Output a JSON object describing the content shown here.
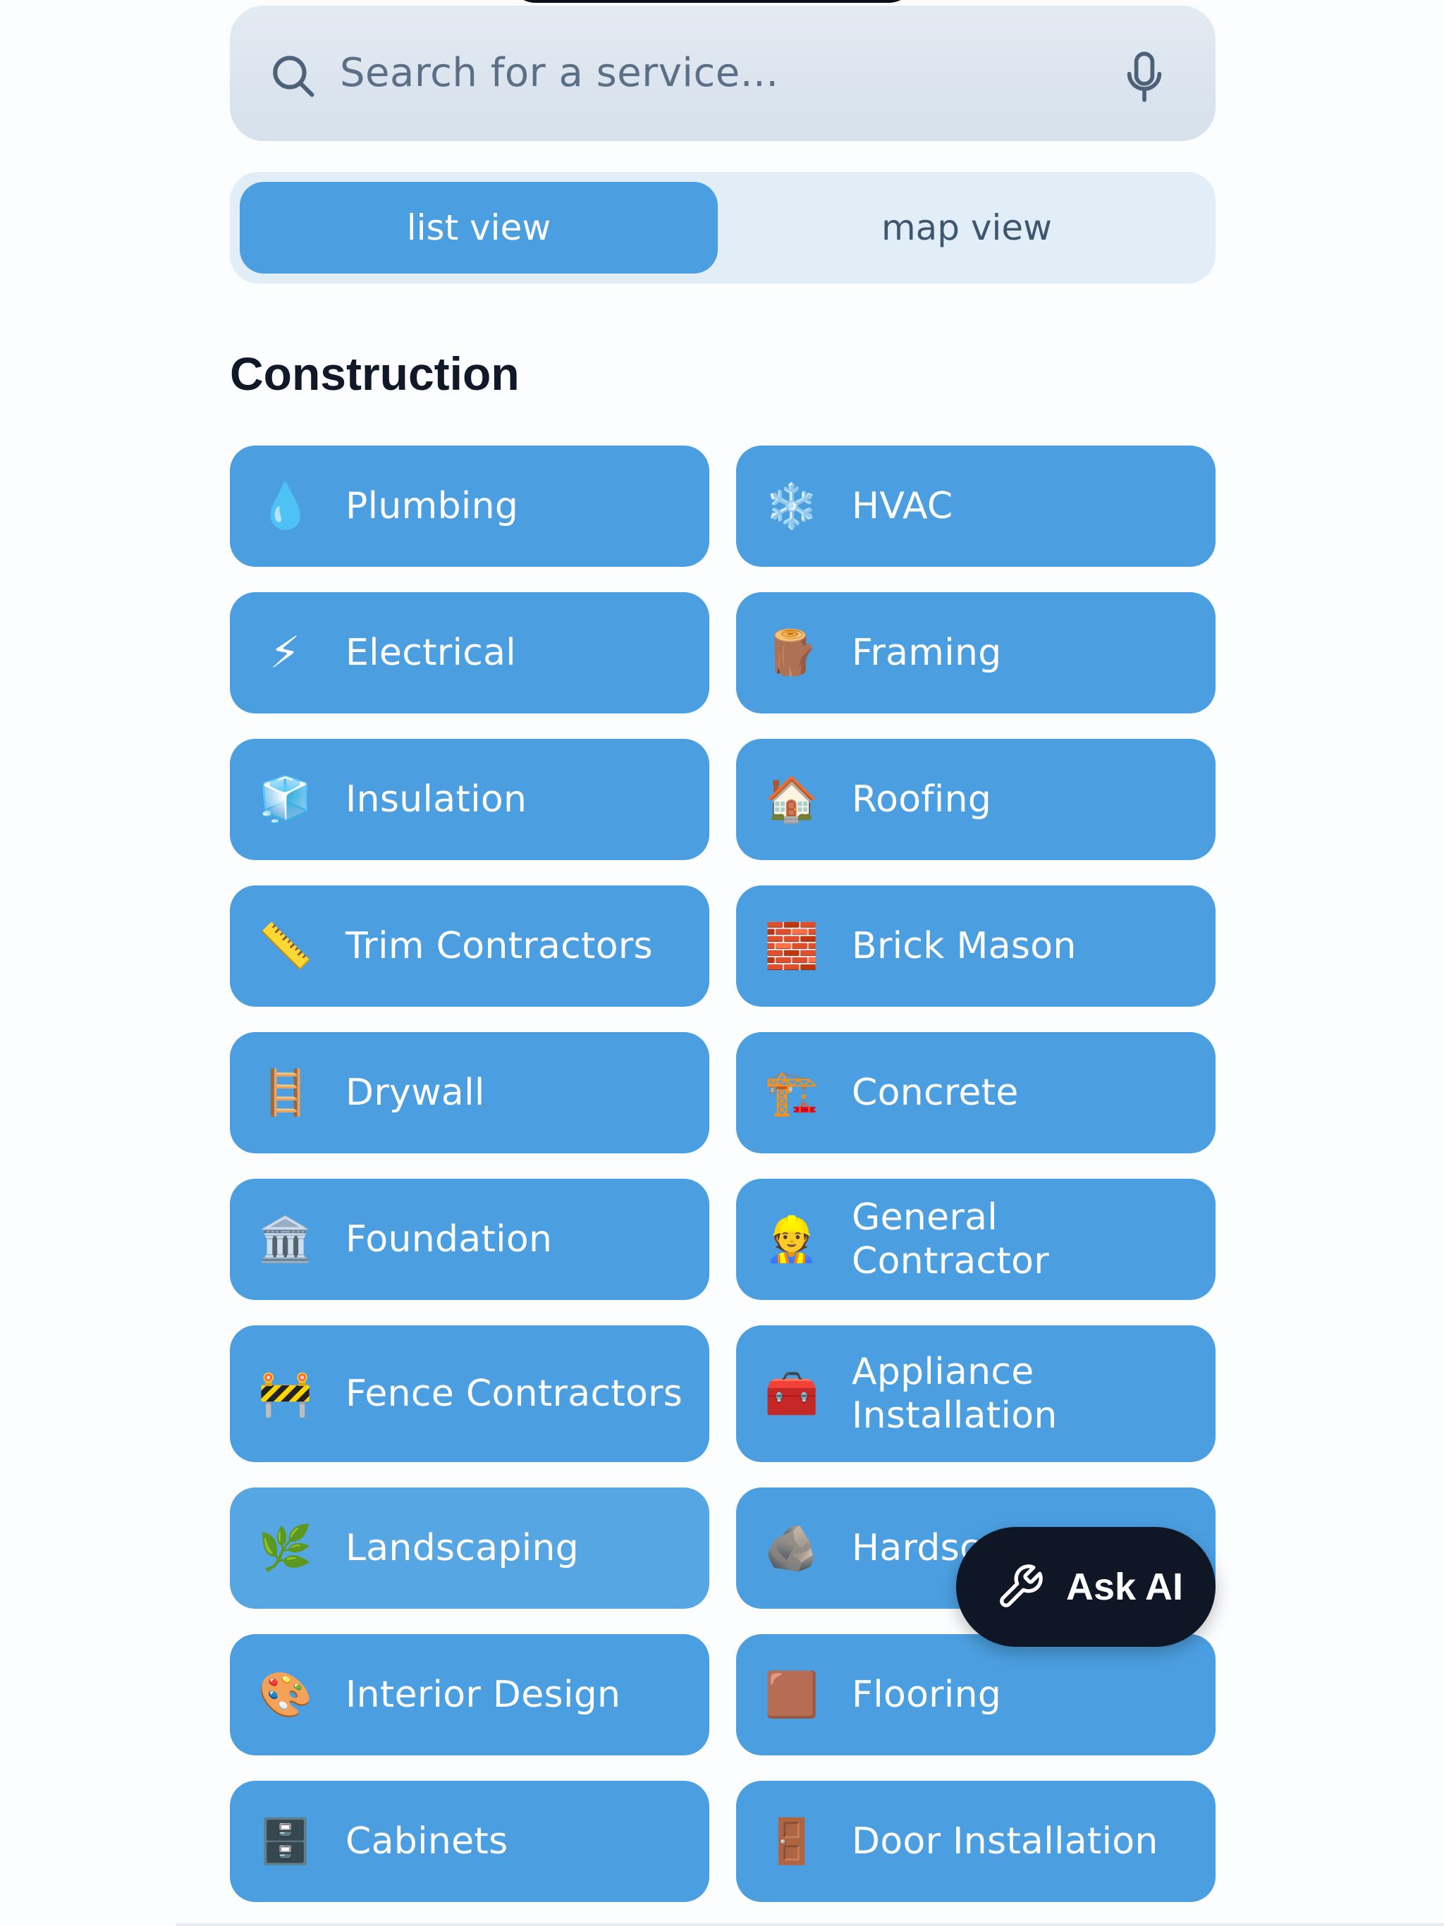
{
  "search": {
    "placeholder": "Search for a service..."
  },
  "view_toggle": {
    "list_label": "list view",
    "map_label": "map view",
    "selected": "list view"
  },
  "section": {
    "title": "Construction"
  },
  "services": [
    {
      "label": "Plumbing",
      "icon": "💧",
      "icon_name": "droplet-icon"
    },
    {
      "label": "HVAC",
      "icon": "❄️",
      "icon_name": "snowflake-icon"
    },
    {
      "label": "Electrical",
      "icon": "⚡",
      "icon_name": "lightning-icon"
    },
    {
      "label": "Framing",
      "icon": "🪵",
      "icon_name": "wood-icon"
    },
    {
      "label": "Insulation",
      "icon": "🧊",
      "icon_name": "ice-cube-icon"
    },
    {
      "label": "Roofing",
      "icon": "🏠",
      "icon_name": "house-icon"
    },
    {
      "label": "Trim Contractors",
      "icon": "📏",
      "icon_name": "ruler-icon"
    },
    {
      "label": "Brick Mason",
      "icon": "🧱",
      "icon_name": "brick-icon"
    },
    {
      "label": "Drywall",
      "icon": "🪜",
      "icon_name": "ladder-icon"
    },
    {
      "label": "Concrete",
      "icon": "🏗️",
      "icon_name": "crane-icon"
    },
    {
      "label": "Foundation",
      "icon": "🏛️",
      "icon_name": "classical-building-icon"
    },
    {
      "label": "General Contractor",
      "icon": "👷",
      "icon_name": "construction-worker-icon"
    },
    {
      "label": "Fence Contractors",
      "icon": "🚧",
      "icon_name": "barrier-icon"
    },
    {
      "label": "Appliance Installation",
      "icon": "🧰",
      "icon_name": "toolbox-icon"
    },
    {
      "label": "Landscaping",
      "icon": "🌿",
      "icon_name": "herb-icon"
    },
    {
      "label": "Hardscaping",
      "icon": "🪨",
      "icon_name": "rock-icon"
    },
    {
      "label": "Interior Design",
      "icon": "🎨",
      "icon_name": "palette-icon"
    },
    {
      "label": "Flooring",
      "icon": "🟫",
      "icon_name": "brown-square-icon"
    },
    {
      "label": "Cabinets",
      "icon": "🗄️",
      "icon_name": "file-cabinet-icon"
    },
    {
      "label": "Door Installation",
      "icon": "🚪",
      "icon_name": "door-icon"
    }
  ],
  "ask_ai": {
    "label": "Ask AI",
    "icon_name": "wrench-icon"
  },
  "colors": {
    "tile": "#4b9fe1",
    "tile_highlight": "#56a6e3",
    "ask_ai_bg": "#0f1626",
    "toggle_bg": "#e1edf7"
  }
}
